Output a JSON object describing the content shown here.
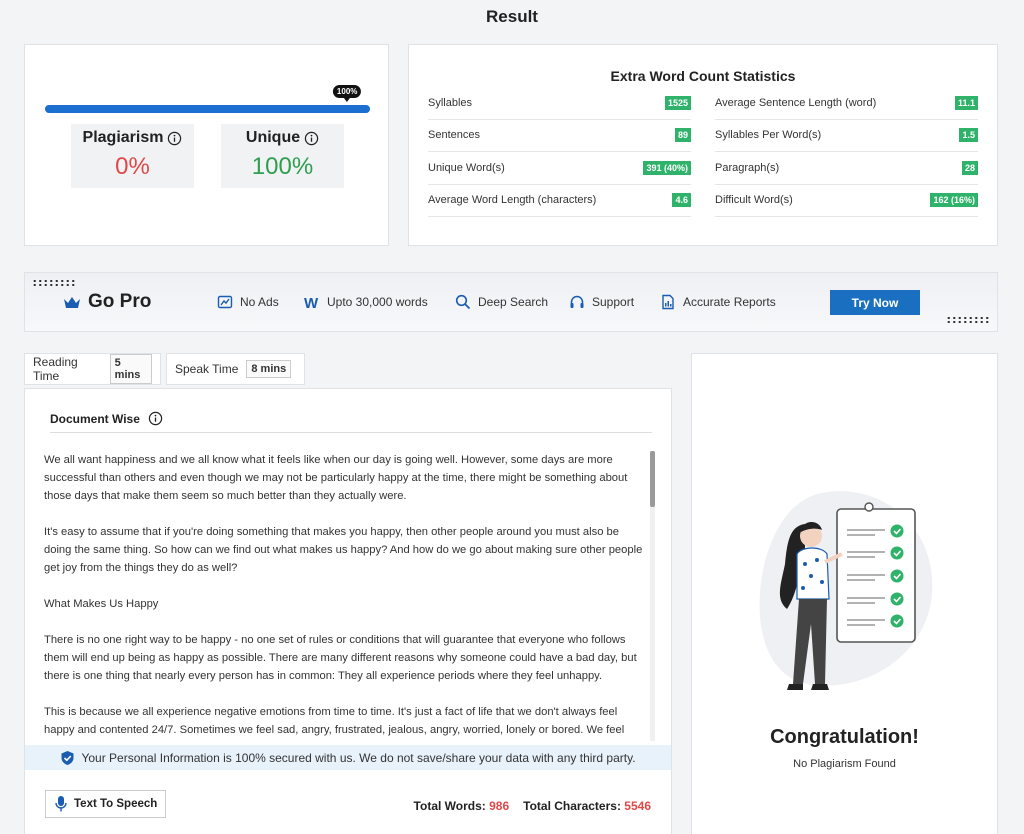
{
  "page_title": "Result",
  "result": {
    "progress_percent": 100,
    "progress_label": "100%",
    "plagiarism_label": "Plagiarism",
    "plagiarism_value": "0%",
    "unique_label": "Unique",
    "unique_value": "100%"
  },
  "stats": {
    "title": "Extra Word Count Statistics",
    "left": [
      {
        "label": "Syllables",
        "value": "1525"
      },
      {
        "label": "Sentences",
        "value": "89"
      },
      {
        "label": "Unique Word(s)",
        "value": "391 (40%)"
      },
      {
        "label": "Average Word Length (characters)",
        "value": "4.6"
      }
    ],
    "right": [
      {
        "label": "Average Sentence Length (word)",
        "value": "11.1"
      },
      {
        "label": "Syllables Per Word(s)",
        "value": "1.5"
      },
      {
        "label": "Paragraph(s)",
        "value": "28"
      },
      {
        "label": "Difficult Word(s)",
        "value": "162 (16%)"
      }
    ]
  },
  "gopro": {
    "title": "Go Pro",
    "features": [
      "No Ads",
      "Upto 30,000 words",
      "Deep Search",
      "Support",
      "Accurate Reports"
    ],
    "cta": "Try Now"
  },
  "tabs": {
    "reading_label": "Reading Time",
    "reading_value": "5 mins",
    "speak_label": "Speak Time",
    "speak_value": "8 mins"
  },
  "document": {
    "header": "Document Wise",
    "paragraphs": [
      "We all want happiness and we all know what it feels like when our day is going well. However, some days are more successful than others and even though we may not be particularly happy at the time, there might be something about those days that make them seem so much better than they actually were.",
      "It's easy to assume that if you're doing something that makes you happy, then other people around you must also be doing the same thing. So how can we find out what makes us happy? And how do we go about making sure other people get joy from the things they do as well?",
      "What Makes Us Happy",
      "There is no one right way to be happy - no one set of rules or conditions that will guarantee that everyone who follows them will end up being as happy as possible. There are many different reasons why someone could have a bad day, but there is one thing that nearly every person has in common: They all experience periods where they feel unhappy.",
      "This is because we all experience negative emotions from time to time. It's just a fact of life that we don't always feel happy and contented 24/7. Sometimes we feel sad, angry, frustrated, jealous, angry, worried, lonely or bored. We feel"
    ],
    "secure_notice": "Your Personal Information is 100% secured with us. We do not save/share your data with any third party.",
    "tts_label": "Text To Speech",
    "total_words_label": "Total Words:",
    "total_words": "986",
    "total_chars_label": "Total Characters:",
    "total_chars": "5546"
  },
  "congrats": {
    "title": "Congratulation!",
    "subtitle": "No Plagiarism Found"
  },
  "colors": {
    "accent_blue": "#1a6fd0",
    "badge_green": "#2fb36b",
    "danger_red": "#e04848",
    "success_green": "#2e9e4f"
  },
  "icons": [
    "info-icon",
    "crown-icon",
    "no-ads-icon",
    "word-icon",
    "search-icon",
    "headset-icon",
    "report-icon",
    "shield-icon",
    "microphone-icon"
  ]
}
